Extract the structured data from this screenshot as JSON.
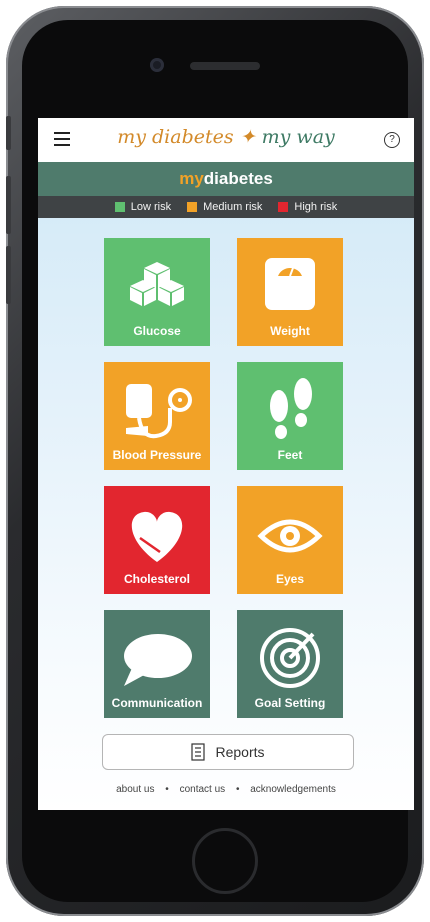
{
  "app": {
    "brand_part1": "my diabetes",
    "brand_sep": " ✦ ",
    "brand_part2": "my way",
    "help_glyph": "?"
  },
  "title": {
    "part1": "my",
    "part2": "diabetes"
  },
  "legend": [
    {
      "label": "Low risk",
      "color": "#5fbf70"
    },
    {
      "label": "Medium risk",
      "color": "#f2a227"
    },
    {
      "label": "High risk",
      "color": "#e2262f"
    }
  ],
  "tiles": {
    "glucose": {
      "label": "Glucose",
      "color": "#5fbf70",
      "icon": "sugar-cubes-icon"
    },
    "weight": {
      "label": "Weight",
      "color": "#f2a227",
      "icon": "scale-icon"
    },
    "blood_pressure": {
      "label": "Blood Pressure",
      "color": "#f2a227",
      "icon": "blood-pressure-cuff-icon"
    },
    "feet": {
      "label": "Feet",
      "color": "#5fbf70",
      "icon": "footprints-icon"
    },
    "cholesterol": {
      "label": "Cholesterol",
      "color": "#e2262f",
      "icon": "heart-icon"
    },
    "eyes": {
      "label": "Eyes",
      "color": "#f2a227",
      "icon": "eye-icon"
    },
    "communication": {
      "label": "Communication",
      "color": "#4f7b6c",
      "icon": "speech-bubble-icon"
    },
    "goal_setting": {
      "label": "Goal Setting",
      "color": "#4f7b6c",
      "icon": "target-icon"
    }
  },
  "reports": {
    "label": "Reports",
    "icon": "document-icon"
  },
  "footer": {
    "about": "about us",
    "contact": "contact us",
    "ack": "acknowledgements",
    "sep": "•"
  }
}
